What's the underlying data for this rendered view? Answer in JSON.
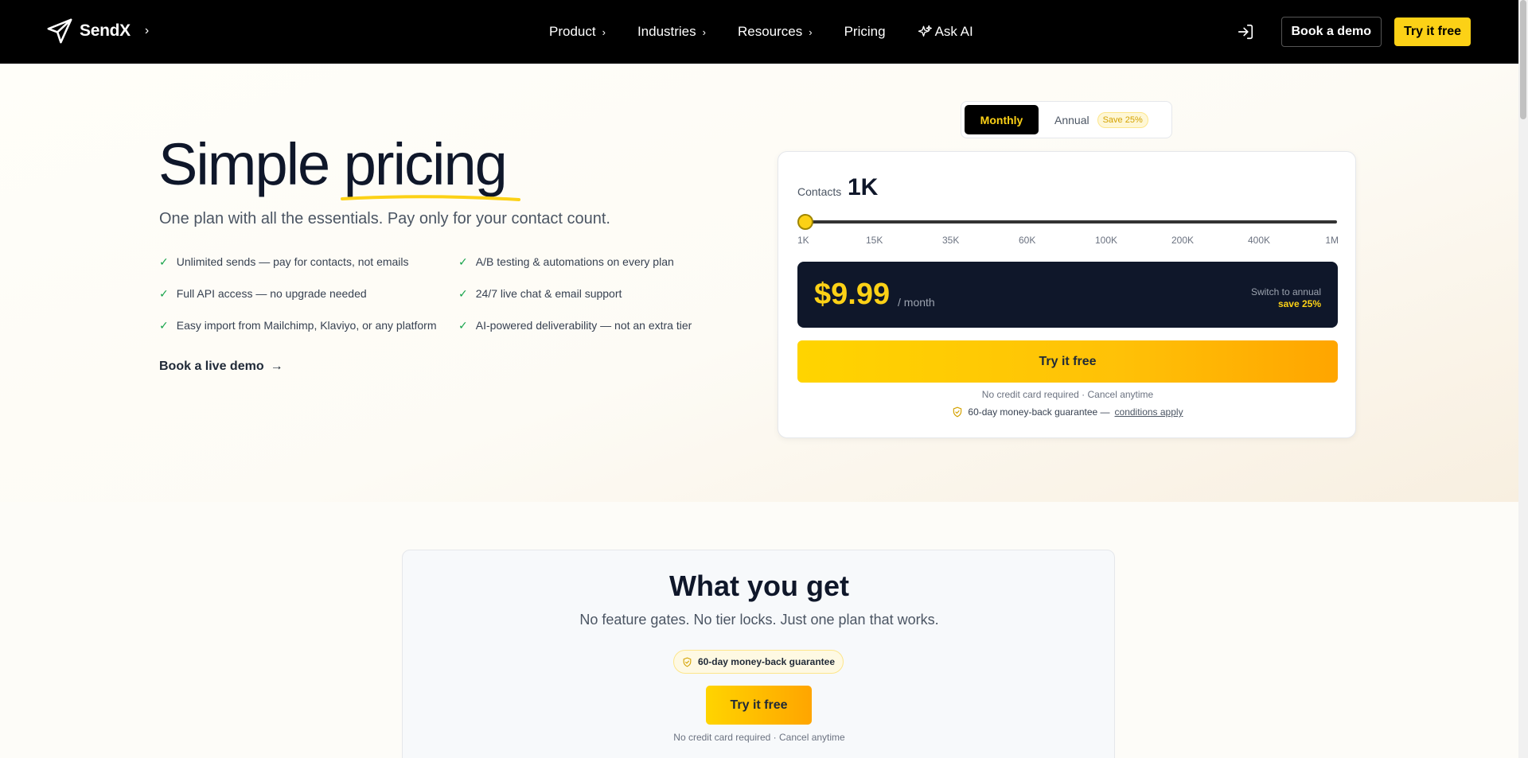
{
  "nav": {
    "brand": "SendX",
    "menu": [
      {
        "label": "Product",
        "has_chevron": true
      },
      {
        "label": "Industries",
        "has_chevron": true
      },
      {
        "label": "Resources",
        "has_chevron": true
      },
      {
        "label": "Pricing",
        "has_chevron": false
      },
      {
        "label": "Ask AI",
        "icon": "sparkle-icon"
      }
    ],
    "book_demo": "Book a demo",
    "try_free": "Try it free"
  },
  "hero": {
    "title_part1": "Simple ",
    "title_part2": "pricing",
    "subtitle": "One plan with all the essentials. Pay only for your contact count.",
    "features": [
      "Unlimited sends — pay for contacts, not emails",
      "A/B testing & automations on every plan",
      "Full API access — no upgrade needed",
      "24/7 live chat & email support",
      "Easy import from Mailchimp, Klaviyo, or any platform",
      "AI-powered deliverability — not an extra tier"
    ],
    "live_demo": "Book a live demo"
  },
  "billing": {
    "monthly": "Monthly",
    "annual": "Annual",
    "save_badge": "Save 25%",
    "selected": "Monthly"
  },
  "pricing_card": {
    "contacts_label": "Contacts",
    "contacts_value": "1K",
    "slider_value_fraction": 0,
    "ticks": [
      "1K",
      "15K",
      "35K",
      "60K",
      "100K",
      "200K",
      "400K",
      "1M"
    ],
    "price": "$9.99",
    "per": "/ month",
    "switch_annual": "Switch to annual",
    "save_annual": "save 25%",
    "try_free": "Try it free",
    "no_cc": "No credit card required · Cancel anytime",
    "guarantee": "60-day money-back guarantee —",
    "conditions": "conditions apply"
  },
  "what_you_get": {
    "title": "What you get",
    "subtitle": "No feature gates. No tier locks. Just one plan that works.",
    "guarantee_pill": "60-day money-back guarantee",
    "try_free": "Try it free",
    "no_cc": "No credit card required · Cancel anytime"
  },
  "colors": {
    "accent": "#fcd116",
    "nav_bg": "#000000",
    "price_box": "#0f172a",
    "check": "#16a34a"
  }
}
